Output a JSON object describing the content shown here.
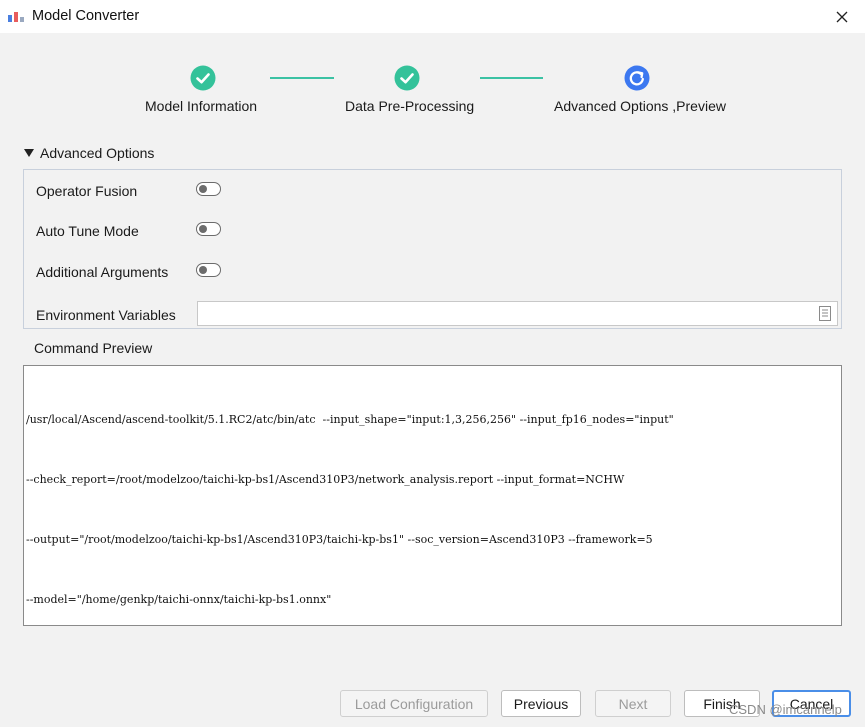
{
  "window": {
    "title": "Model Converter",
    "close_icon": "close-icon"
  },
  "stepper": {
    "steps": [
      {
        "label": "Model Information",
        "status": "complete"
      },
      {
        "label": "Data Pre-Processing",
        "status": "complete"
      },
      {
        "label": "Advanced Options ,Preview",
        "status": "in-progress"
      }
    ],
    "complete_color": "#34c29a",
    "active_color": "#3c78f0"
  },
  "advanced_options": {
    "title": "Advanced Options",
    "expanded": true,
    "options": [
      {
        "label": "Operator Fusion",
        "enabled": false
      },
      {
        "label": "Auto Tune Mode",
        "enabled": false
      },
      {
        "label": "Additional Arguments",
        "enabled": false
      }
    ],
    "env_label": "Environment Variables",
    "env_value": ""
  },
  "command_preview": {
    "label": "Command Preview",
    "lines": [
      "/usr/local/Ascend/ascend-toolkit/5.1.RC2/atc/bin/atc  --input_shape=\"input:1,3,256,256\" --input_fp16_nodes=\"input\"",
      "--check_report=/root/modelzoo/taichi-kp-bs1/Ascend310P3/network_analysis.report --input_format=NCHW",
      "--output=\"/root/modelzoo/taichi-kp-bs1/Ascend310P3/taichi-kp-bs1\" --soc_version=Ascend310P3 --framework=5",
      "--model=\"/home/genkp/taichi-onnx/taichi-kp-bs1.onnx\""
    ]
  },
  "footer": {
    "load_config": "Load Configuration",
    "previous": "Previous",
    "next": "Next",
    "finish": "Finish",
    "cancel": "Cancel"
  },
  "watermark": "CSDN @imcannelp"
}
